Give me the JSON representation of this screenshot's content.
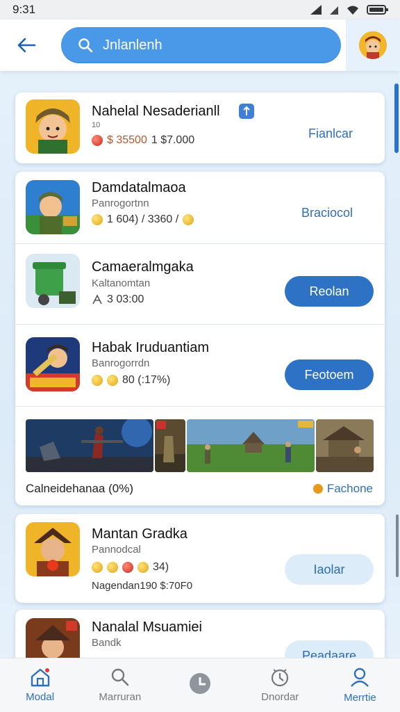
{
  "status_bar": {
    "time": "9:31"
  },
  "header": {
    "search_text": "Jnlanlenh"
  },
  "apps": [
    {
      "title": "Nahelal Nesaderianll",
      "sub": "10",
      "meta_price": "$ 35500",
      "meta_rest": "1 $7.000",
      "action": "Fianlcar"
    },
    {
      "title": "Damdatalmaoa",
      "sub": "Panrogortnn",
      "meta": "1 604) / 3360 /",
      "action": "Braciocol"
    },
    {
      "title": "Camaeralmgaka",
      "sub": "Kaltanomtan",
      "meta": "3 03:00",
      "action": "Reolan"
    },
    {
      "title": "Habak Iruduantiam",
      "sub": "Banrogorrdn",
      "meta": "80 (:17%)",
      "action": "Feotoem"
    },
    {
      "title": "Mantan Gradka",
      "sub": "Pannodcal",
      "meta": "34)",
      "meta2": "Nagendan190 $:70F0",
      "action": "Iaolar"
    },
    {
      "title": "Nanalal Msuamiei",
      "sub": "Bandk",
      "action": "Peadaare"
    }
  ],
  "gallery": {
    "caption": "Calneidehanaa (0%)",
    "action": "Fachone"
  },
  "nav": [
    {
      "label": "Modal",
      "icon": "home-icon"
    },
    {
      "label": "Marruran",
      "icon": "search-icon"
    },
    {
      "label": "",
      "icon": "clock-icon"
    },
    {
      "label": "Dnordar",
      "icon": "calendar-icon"
    },
    {
      "label": "Merrtie",
      "icon": "profile-icon"
    }
  ],
  "colors": {
    "accent": "#2d72c4",
    "search": "#4a98e8",
    "background": "#e6f1fb"
  }
}
